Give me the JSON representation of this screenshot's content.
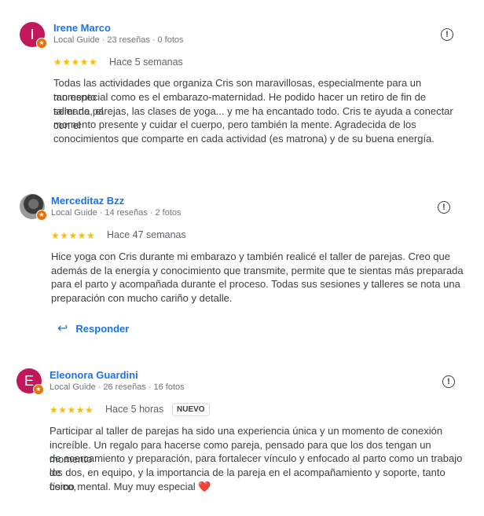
{
  "reviews": [
    {
      "avatar_letter": "I",
      "avatar_color": "#c2185b",
      "name": "Irene Marco",
      "guide_label": "Local Guide",
      "reviews_count": "23 reseñas",
      "photos_count": "0 fotos",
      "rating": 5,
      "stars": "★★★★★",
      "date": "Hace 5 semanas",
      "lines": [
        "Todas las actividades que organiza Cris son maravillosas, especialmente para un momento",
        "tan especial como es el embarazo-maternidad. He podido hacer un retiro de fin de semana, el",
        "taller de parejas, las clases de yoga... y me ha encantado todo. Cris te ayuda a conectar con el",
        "momento presente y cuidar el cuerpo, pero también la mente. Agradecida de los",
        "conocimientos que comparte en cada actividad (es matrona) y de su buena energía."
      ]
    },
    {
      "avatar_letter": "",
      "name": "Merceditaz Bzz",
      "guide_label": "Local Guide",
      "reviews_count": "14 reseñas",
      "photos_count": "2 fotos",
      "rating": 5,
      "stars": "★★★★★",
      "date": "Hace 47 semanas",
      "lines": [
        "Hice yoga con Cris durante mi embarazo y también realicé el taller de parejas. Creo que",
        "además de la energía y conocimiento que transmite, permite que te sientas más preparada",
        "para el parto y acompañada durante el proceso. Todas sus sesiones y talleres se nota una",
        "preparación con mucho cariño y detalle."
      ],
      "reply_label": "Responder"
    },
    {
      "avatar_letter": "E",
      "avatar_color": "#c2185b",
      "name": "Eleonora Guardini",
      "guide_label": "Local Guide",
      "reviews_count": "26 reseñas",
      "photos_count": "16 fotos",
      "rating": 5,
      "stars": "★★★★★",
      "date": "Hace 5 horas",
      "badge": "NUEVO",
      "lines": [
        "Participar al taller de parejas ha sido una experiencia única y un momento de conexión",
        "increíble. Un regalo para hacerse como pareja, pensado para que los dos tengan un momento",
        "de acercamiento y preparación, para fortalecer vínculo y enfocado al parto como un trabajo de",
        "los dos, en equipo, y la importancia de la pareja en el acompañamiento y soporte, tanto físico,",
        "como mental. Muy muy especial ❤️"
      ]
    }
  ],
  "icons": {
    "guide_badge": "star-badge-icon",
    "flag": "report-flag-icon",
    "reply": "reply-arrow-icon"
  },
  "glyphs": {
    "flag": "!",
    "reply_arrow": "↩",
    "badge_star": "★",
    "dot": "·"
  }
}
